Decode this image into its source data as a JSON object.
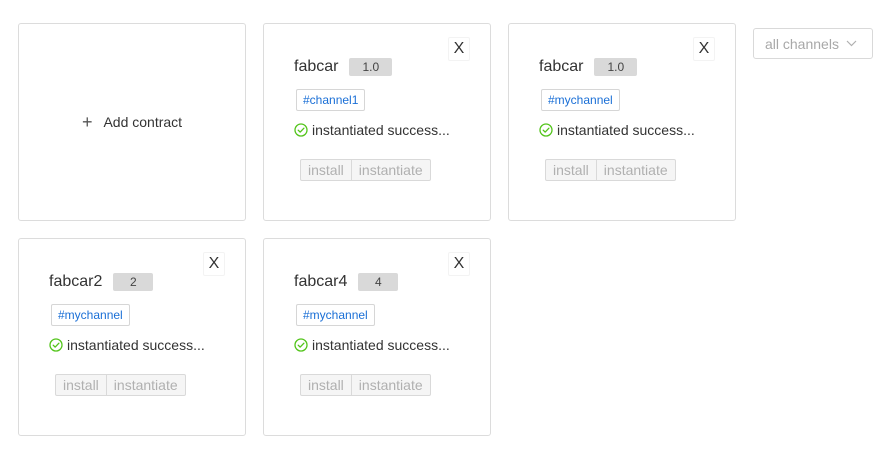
{
  "add_contract": {
    "label": "Add contract",
    "icon": "plus-icon"
  },
  "channel_filter": {
    "value": "all channels",
    "icon": "chevron-down-icon"
  },
  "cards": [
    {
      "name": "fabcar",
      "version": "1.0",
      "channel": "#channel1",
      "status": "instantiated success...",
      "status_color": "#52c41a",
      "install_label": "install",
      "instantiate_label": "instantiate",
      "close_label": "X"
    },
    {
      "name": "fabcar",
      "version": "1.0",
      "channel": "#mychannel",
      "status": "instantiated success...",
      "status_color": "#52c41a",
      "install_label": "install",
      "instantiate_label": "instantiate",
      "close_label": "X"
    },
    {
      "name": "fabcar2",
      "version": "2",
      "channel": "#mychannel",
      "status": "instantiated success...",
      "status_color": "#52c41a",
      "install_label": "install",
      "instantiate_label": "instantiate",
      "close_label": "X"
    },
    {
      "name": "fabcar4",
      "version": "4",
      "channel": "#mychannel",
      "status": "instantiated success...",
      "status_color": "#52c41a",
      "install_label": "install",
      "instantiate_label": "instantiate",
      "close_label": "X"
    }
  ]
}
